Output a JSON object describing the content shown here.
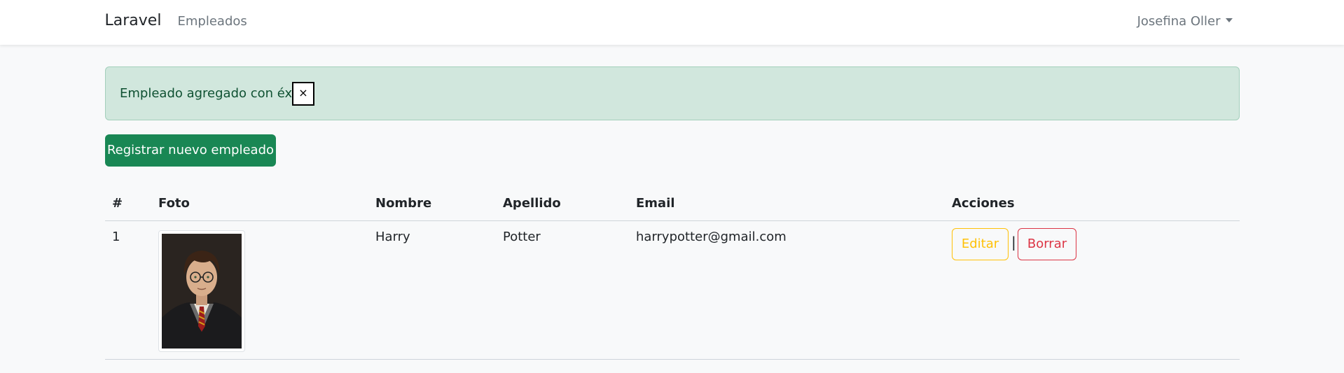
{
  "nav": {
    "brand": "Laravel",
    "link": "Empleados",
    "user": "Josefina Oller"
  },
  "alert": {
    "message": "Empleado agregado con éxito",
    "close": "×"
  },
  "actions": {
    "create_label": "Registrar nuevo empleado"
  },
  "table": {
    "headers": [
      "#",
      "Foto",
      "Nombre",
      "Apellido",
      "Email",
      "Acciones"
    ],
    "rows": [
      {
        "id": "1",
        "nombre": "Harry",
        "apellido": "Potter",
        "email": "harrypotter@gmail.com",
        "edit_label": "Editar",
        "separator": "|",
        "delete_label": "Borrar"
      }
    ]
  },
  "colors": {
    "success": "#198754",
    "alert_bg": "#d1e7dd",
    "warning": "#ffc107",
    "danger": "#dc3545"
  }
}
